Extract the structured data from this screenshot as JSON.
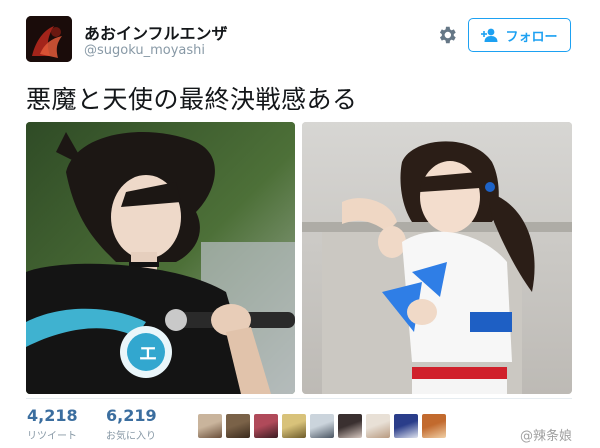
{
  "tweet": {
    "display_name": "あおインフルエンザ",
    "handle": "@sugoku_moyashi",
    "text": "悪魔と天使の最終決戦感ある",
    "avatar": {
      "icon": "user-avatar",
      "colors": [
        "#1a0c0a",
        "#a3241a",
        "#e25a3a"
      ]
    }
  },
  "actions": {
    "settings_icon": "gear-icon",
    "follow_label": "フォロー",
    "follow_icon": "add-user-icon"
  },
  "media": [
    {
      "name": "photo-left",
      "description_icon": "photo"
    },
    {
      "name": "photo-right",
      "description_icon": "photo"
    }
  ],
  "stats": {
    "retweets": {
      "count": "4,218",
      "label": "リツイート"
    },
    "likes": {
      "count": "6,219",
      "label": "お気に入り"
    }
  },
  "likers": [
    {
      "colors": [
        "#c9b49c",
        "#6a4f3a"
      ]
    },
    {
      "colors": [
        "#7a6248",
        "#3a2a1c"
      ]
    },
    {
      "colors": [
        "#b04a5a",
        "#3a1c22"
      ]
    },
    {
      "colors": [
        "#d8c27a",
        "#6d5b2a"
      ]
    },
    {
      "colors": [
        "#cbd4dc",
        "#4a5562"
      ]
    },
    {
      "colors": [
        "#3a3030",
        "#d7c8c0"
      ]
    },
    {
      "colors": [
        "#e8e0d6",
        "#b89a80"
      ]
    },
    {
      "colors": [
        "#2a3d8a",
        "#dfe3ef"
      ]
    },
    {
      "colors": [
        "#c26a2e",
        "#f1d0a6"
      ]
    }
  ],
  "watermark": "@辣条娘",
  "colors": {
    "accent": "#1da1f2",
    "stat_number": "#3b6e9f",
    "muted": "#8899a6"
  }
}
